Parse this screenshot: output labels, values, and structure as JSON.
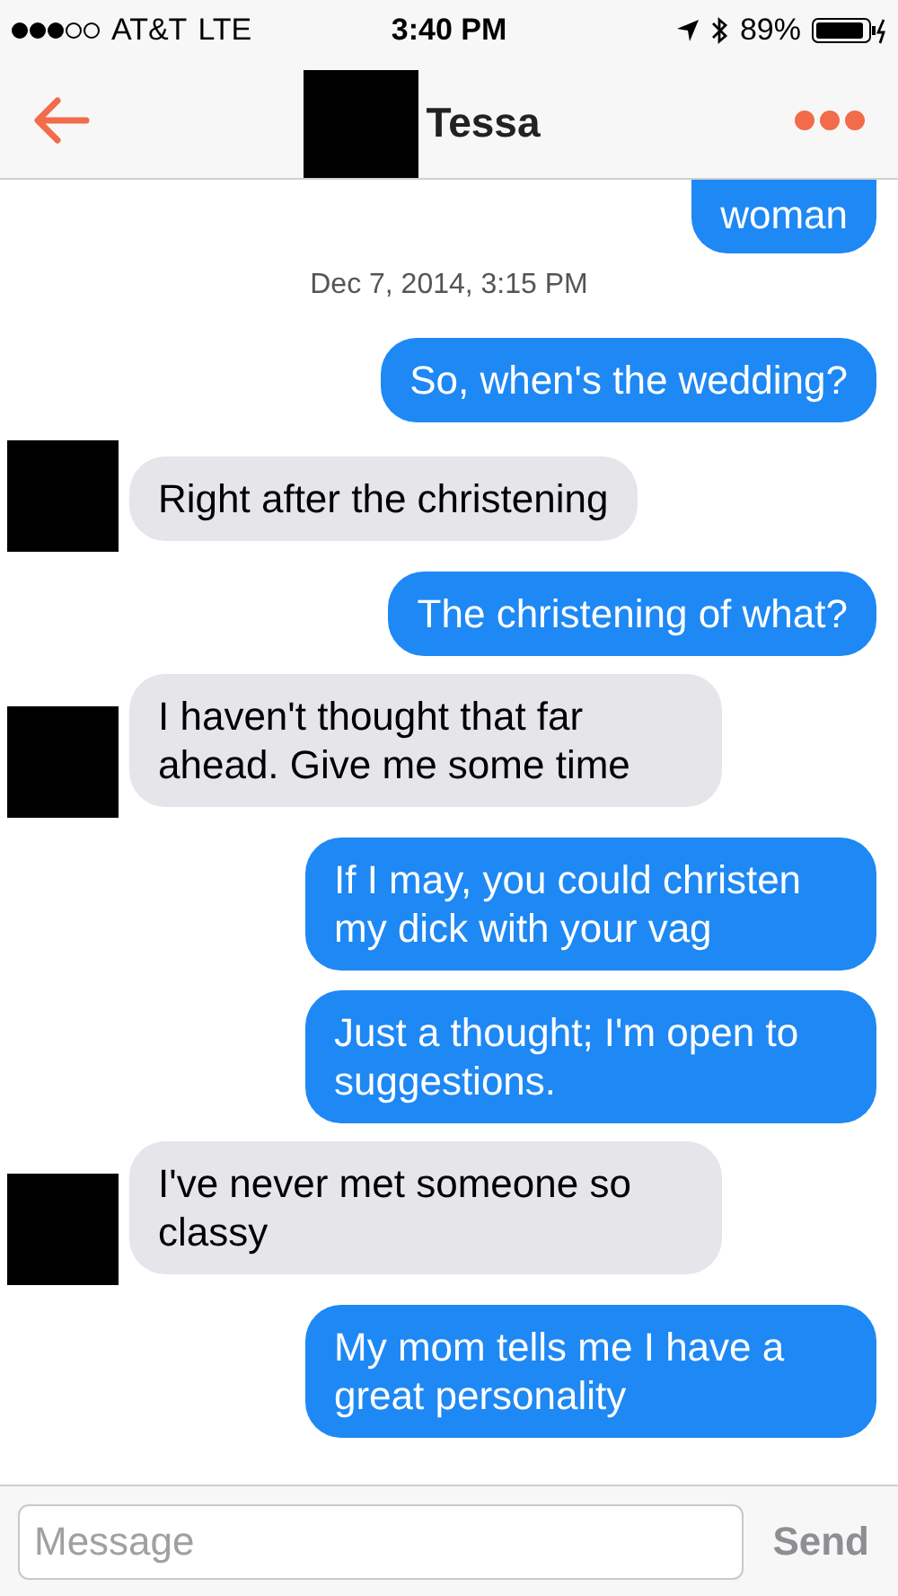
{
  "status_bar": {
    "carrier": "AT&T",
    "network": "LTE",
    "time": "3:40 PM",
    "battery": "89%"
  },
  "header": {
    "title": "Tessa"
  },
  "messages": [
    {
      "kind": "sent",
      "text": "woman",
      "cut_top": true
    },
    {
      "kind": "timestamp",
      "text": "Dec 7, 2014, 3:15 PM"
    },
    {
      "kind": "sent",
      "text": "So, when's the wedding?"
    },
    {
      "kind": "received",
      "text": "Right after the christening"
    },
    {
      "kind": "sent",
      "text": "The christening of what?"
    },
    {
      "kind": "received",
      "text": "I haven't thought that far ahead. Give me some time"
    },
    {
      "kind": "sent",
      "text": "If I may, you could christen my dick with your vag"
    },
    {
      "kind": "sent",
      "text": "Just a thought; I'm open to suggestions."
    },
    {
      "kind": "received",
      "text": "I've never met someone so classy"
    },
    {
      "kind": "sent",
      "text": "My mom tells me I have a great personality"
    }
  ],
  "composer": {
    "placeholder": "Message",
    "send": "Send"
  }
}
